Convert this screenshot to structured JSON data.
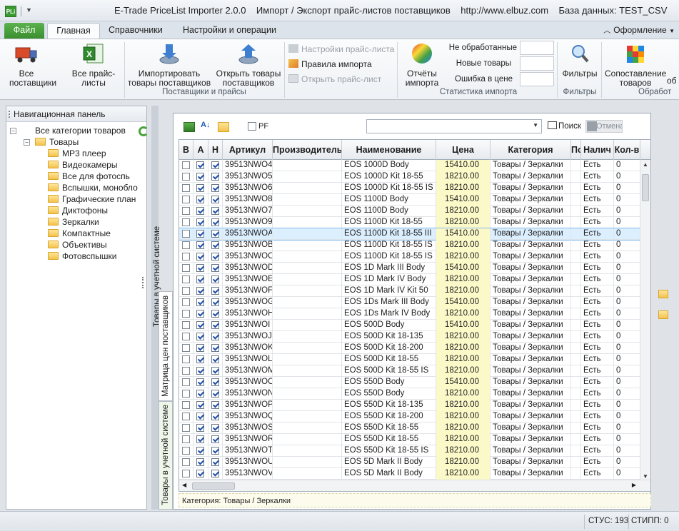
{
  "titlebar": {
    "logo": "PLi",
    "title": "E-Trade PriceList Importer 2.0.0    Импорт / Экспорт прайс-листов поставщиков    http://www.elbuz.com    База данных: TEST_CSV"
  },
  "ribbon_tabs": {
    "file": "Файл",
    "home": "Главная",
    "references": "Справочники",
    "settings": "Настройки и операции",
    "design": "Оформление"
  },
  "ribbon": {
    "all_suppliers": "Все поставщики",
    "all_pricelists": "Все прайс-листы",
    "import_suppliers": "Импортировать товары поставщиков",
    "open_supplier_goods": "Открыть товары поставщиков",
    "group_suppliers": "Поставщики и прайсы",
    "pricelist_settings": "Настройки прайс-листа",
    "import_rules": "Правила импорта",
    "open_pricelist": "Открыть прайс-лист",
    "import_reports": "Отчёты импорта",
    "not_processed": "Не обработанные",
    "new_goods": "Новые товары",
    "price_error": "Ошибка в цене",
    "group_stats": "Статистика импорта",
    "filters": "Фильтры",
    "group_filters": "Фильтры",
    "compare_goods": "Сопоставление товаров",
    "group_processing": "Обработ",
    "extra": "об"
  },
  "nav": {
    "title": "Навигационная панель",
    "root": "Все категории товаров",
    "goods": "Товары",
    "categories": [
      "MP3 плеер",
      "Видеокамеры",
      "Все для фотоспь",
      "Вспышки, монобло",
      "Графические план",
      "Диктофоны",
      "Зеркалки",
      "Компактные",
      "Объективы",
      "Фотовспышки"
    ]
  },
  "vtabs": {
    "outer": "Товары в учетной системе",
    "matrix": "Матрица цен поставщиков",
    "inner": "Товары в учетной системе"
  },
  "toolbar": {
    "pf": "PF",
    "find": "Поиск",
    "cancel": "Отмена"
  },
  "grid": {
    "headers": [
      "В",
      "А",
      "Н",
      "Артикул",
      "Производитель",
      "Наименование",
      "Цена",
      "Категория",
      "По",
      "Налич",
      "Кол-в"
    ],
    "rows": [
      {
        "v": false,
        "a": true,
        "n": true,
        "sku": "39513NWO4",
        "mfr": "",
        "name": "EOS 1000D Body",
        "price": "15410.00",
        "cat": "Товары / Зеркалки",
        "avail": "Есть",
        "qty": "0"
      },
      {
        "v": false,
        "a": true,
        "n": true,
        "sku": "39513NWO5",
        "mfr": "",
        "name": "EOS 1000D Kit 18-55",
        "price": "18210.00",
        "cat": "Товары / Зеркалки",
        "avail": "Есть",
        "qty": "0"
      },
      {
        "v": false,
        "a": true,
        "n": true,
        "sku": "39513NWO6",
        "mfr": "",
        "name": "EOS 1000D Kit 18-55 IS",
        "price": "18210.00",
        "cat": "Товары / Зеркалки",
        "avail": "Есть",
        "qty": "0"
      },
      {
        "v": false,
        "a": true,
        "n": true,
        "sku": "39513NWO8",
        "mfr": "",
        "name": "EOS 1100D Body",
        "price": "15410.00",
        "cat": "Товары / Зеркалки",
        "avail": "Есть",
        "qty": "0"
      },
      {
        "v": false,
        "a": true,
        "n": true,
        "sku": "39513NWO7",
        "mfr": "",
        "name": "EOS 1100D Body",
        "price": "18210.00",
        "cat": "Товары / Зеркалки",
        "avail": "Есть",
        "qty": "0"
      },
      {
        "v": false,
        "a": true,
        "n": true,
        "sku": "39513NWO9",
        "mfr": "",
        "name": "EOS 1100D Kit 18-55",
        "price": "18210.00",
        "cat": "Товары / Зеркалки",
        "avail": "Есть",
        "qty": "0"
      },
      {
        "v": false,
        "a": true,
        "n": true,
        "sku": "39513NWOA",
        "mfr": "",
        "name": "EOS 1100D Kit 18-55 III",
        "price": "15410.00",
        "cat": "Товары / Зеркалки",
        "avail": "Есть",
        "qty": "0",
        "selected": true
      },
      {
        "v": false,
        "a": true,
        "n": true,
        "sku": "39513NWOB",
        "mfr": "",
        "name": "EOS 1100D Kit 18-55 IS",
        "price": "18210.00",
        "cat": "Товары / Зеркалки",
        "avail": "Есть",
        "qty": "0"
      },
      {
        "v": false,
        "a": true,
        "n": true,
        "sku": "39513NWOC",
        "mfr": "",
        "name": "EOS 1100D Kit 18-55 IS II",
        "price": "18210.00",
        "cat": "Товары / Зеркалки",
        "avail": "Есть",
        "qty": "0"
      },
      {
        "v": false,
        "a": true,
        "n": true,
        "sku": "39513NWOD",
        "mfr": "",
        "name": "EOS 1D Mark III Body",
        "price": "15410.00",
        "cat": "Товары / Зеркалки",
        "avail": "Есть",
        "qty": "0"
      },
      {
        "v": false,
        "a": true,
        "n": true,
        "sku": "39513NWOE",
        "mfr": "",
        "name": "EOS 1D Mark IV Body",
        "price": "18210.00",
        "cat": "Товары / Зеркалки",
        "avail": "Есть",
        "qty": "0"
      },
      {
        "v": false,
        "a": true,
        "n": true,
        "sku": "39513NWOF",
        "mfr": "",
        "name": "EOS 1D Mark IV Kit 50",
        "price": "18210.00",
        "cat": "Товары / Зеркалки",
        "avail": "Есть",
        "qty": "0"
      },
      {
        "v": false,
        "a": true,
        "n": true,
        "sku": "39513NWOG",
        "mfr": "",
        "name": "EOS 1Ds Mark III Body",
        "price": "15410.00",
        "cat": "Товары / Зеркалки",
        "avail": "Есть",
        "qty": "0"
      },
      {
        "v": false,
        "a": true,
        "n": true,
        "sku": "39513NWOH",
        "mfr": "",
        "name": "EOS 1Ds Mark IV Body",
        "price": "18210.00",
        "cat": "Товары / Зеркалки",
        "avail": "Есть",
        "qty": "0"
      },
      {
        "v": false,
        "a": true,
        "n": true,
        "sku": "39513NWOI",
        "mfr": "",
        "name": "EOS 500D Body",
        "price": "15410.00",
        "cat": "Товары / Зеркалки",
        "avail": "Есть",
        "qty": "0"
      },
      {
        "v": false,
        "a": true,
        "n": true,
        "sku": "39513NWOJ",
        "mfr": "",
        "name": "EOS 500D Kit 18-135",
        "price": "18210.00",
        "cat": "Товары / Зеркалки",
        "avail": "Есть",
        "qty": "0"
      },
      {
        "v": false,
        "a": true,
        "n": true,
        "sku": "39513NWOK",
        "mfr": "",
        "name": "EOS 500D Kit 18-200",
        "price": "18210.00",
        "cat": "Товары / Зеркалки",
        "avail": "Есть",
        "qty": "0"
      },
      {
        "v": false,
        "a": true,
        "n": true,
        "sku": "39513NWOL",
        "mfr": "",
        "name": "EOS 500D Kit 18-55",
        "price": "18210.00",
        "cat": "Товары / Зеркалки",
        "avail": "Есть",
        "qty": "0"
      },
      {
        "v": false,
        "a": true,
        "n": true,
        "sku": "39513NWOM",
        "mfr": "",
        "name": "EOS 500D Kit 18-55 IS",
        "price": "18210.00",
        "cat": "Товары / Зеркалки",
        "avail": "Есть",
        "qty": "0"
      },
      {
        "v": false,
        "a": true,
        "n": true,
        "sku": "39513NWOO",
        "mfr": "",
        "name": "EOS 550D Body",
        "price": "15410.00",
        "cat": "Товары / Зеркалки",
        "avail": "Есть",
        "qty": "0"
      },
      {
        "v": false,
        "a": true,
        "n": true,
        "sku": "39513NWON",
        "mfr": "",
        "name": "EOS 550D Body",
        "price": "18210.00",
        "cat": "Товары / Зеркалки",
        "avail": "Есть",
        "qty": "0"
      },
      {
        "v": false,
        "a": true,
        "n": true,
        "sku": "39513NWOP",
        "mfr": "",
        "name": "EOS 550D Kit 18-135",
        "price": "18210.00",
        "cat": "Товары / Зеркалки",
        "avail": "Есть",
        "qty": "0"
      },
      {
        "v": false,
        "a": true,
        "n": true,
        "sku": "39513NWOQ",
        "mfr": "",
        "name": "EOS 550D Kit 18-200",
        "price": "18210.00",
        "cat": "Товары / Зеркалки",
        "avail": "Есть",
        "qty": "0"
      },
      {
        "v": false,
        "a": true,
        "n": true,
        "sku": "39513NWOS",
        "mfr": "",
        "name": "EOS 550D Kit 18-55",
        "price": "18210.00",
        "cat": "Товары / Зеркалки",
        "avail": "Есть",
        "qty": "0"
      },
      {
        "v": false,
        "a": true,
        "n": true,
        "sku": "39513NWOR",
        "mfr": "",
        "name": "EOS 550D Kit 18-55",
        "price": "18210.00",
        "cat": "Товары / Зеркалки",
        "avail": "Есть",
        "qty": "0"
      },
      {
        "v": false,
        "a": true,
        "n": true,
        "sku": "39513NWOT",
        "mfr": "",
        "name": "EOS 550D Kit 18-55 IS",
        "price": "18210.00",
        "cat": "Товары / Зеркалки",
        "avail": "Есть",
        "qty": "0"
      },
      {
        "v": false,
        "a": true,
        "n": true,
        "sku": "39513NWOU",
        "mfr": "",
        "name": "EOS 5D Mark II Body",
        "price": "18210.00",
        "cat": "Товары / Зеркалки",
        "avail": "Есть",
        "qty": "0"
      },
      {
        "v": false,
        "a": true,
        "n": true,
        "sku": "39513NWOV",
        "mfr": "",
        "name": "EOS 5D Mark II Body",
        "price": "18210.00",
        "cat": "Товары / Зеркалки",
        "avail": "Есть",
        "qty": "0"
      }
    ]
  },
  "grid_footer": "Категория: Товары / Зеркалки",
  "statusbar": {
    "stus": "СТУС: 193",
    "stipp": "СТИПП: 0"
  },
  "colors": {
    "file_tab": "#3a8e2f",
    "price_bg": "#fcf9c9",
    "selection": "#dcefff"
  }
}
